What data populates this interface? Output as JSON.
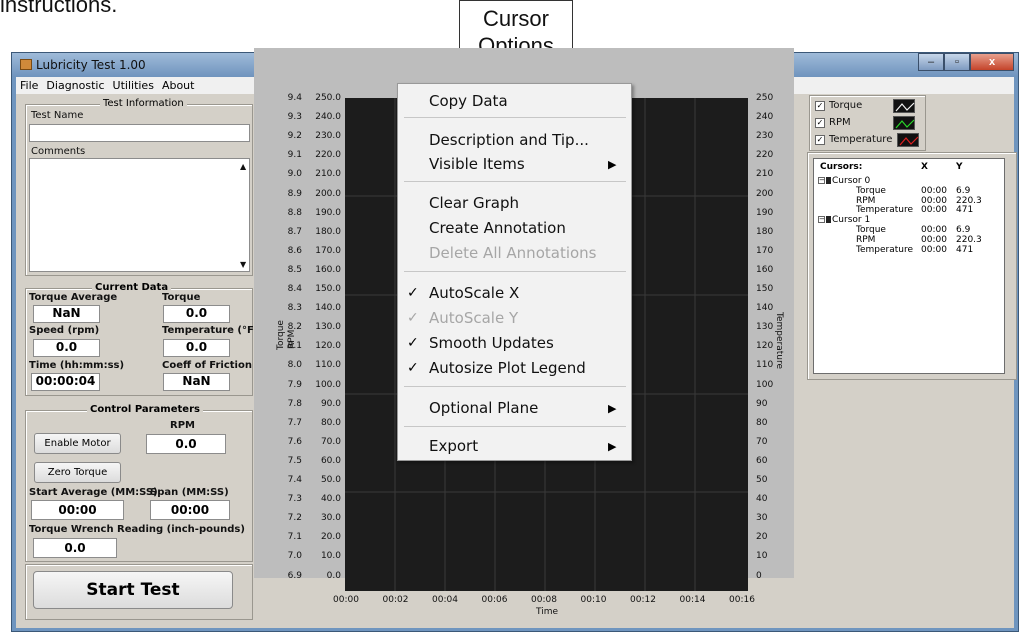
{
  "intro_text": "instructions.",
  "callout": {
    "line1": "Cursor",
    "line2": "Options"
  },
  "window": {
    "title": "Lubricity Test 1.00",
    "min": "–",
    "max": "▫",
    "close": "x"
  },
  "menubar": [
    "File",
    "Diagnostic",
    "Utilities",
    "About"
  ],
  "test_info": {
    "legend": "Test Information",
    "test_name_label": "Test Name",
    "test_name_value": "",
    "comments_label": "Comments",
    "comments_value": ""
  },
  "current_data": {
    "legend": "Current Data",
    "torque_avg_label": "Torque Average",
    "torque_avg_value": "NaN",
    "torque_label": "Torque",
    "torque_value": "0.0",
    "speed_label": "Speed (rpm)",
    "speed_value": "0.0",
    "temperature_label": "Temperature (°F)",
    "temperature_value": "0.0",
    "time_label": "Time (hh:mm:ss)",
    "time_value": "00:00:04",
    "cof_label": "Coeff of Friction",
    "cof_value": "NaN"
  },
  "control": {
    "legend": "Control Parameters",
    "rpm_label": "RPM",
    "rpm_value": "0.0",
    "enable_motor": "Enable Motor",
    "zero_torque": "Zero Torque",
    "start_avg_label": "Start Average (MM:SS)",
    "start_avg_value": "00:00",
    "span_label": "Span (MM:SS)",
    "span_value": "00:00",
    "wrench_label": "Torque Wrench Reading (inch-pounds)",
    "wrench_value": "0.0"
  },
  "start_test": "Start Test",
  "axes": {
    "torque_label": "Torque",
    "rpm_label": "RPM",
    "temperature_label": "Temperature",
    "x_label": "Time",
    "torque_ticks": [
      "9.4",
      "9.3",
      "9.2",
      "9.1",
      "9.0",
      "8.9",
      "8.8",
      "8.7",
      "8.6",
      "8.5",
      "8.4",
      "8.3",
      "8.2",
      "8.1",
      "8.0",
      "7.9",
      "7.8",
      "7.7",
      "7.6",
      "7.5",
      "7.4",
      "7.3",
      "7.2",
      "7.1",
      "7.0",
      "6.9"
    ],
    "rpm_ticks": [
      "250.0",
      "240.0",
      "230.0",
      "220.0",
      "210.0",
      "200.0",
      "190.0",
      "180.0",
      "170.0",
      "160.0",
      "150.0",
      "140.0",
      "130.0",
      "120.0",
      "110.0",
      "100.0",
      "90.0",
      "80.0",
      "70.0",
      "60.0",
      "50.0",
      "40.0",
      "30.0",
      "20.0",
      "10.0",
      "0.0"
    ],
    "temp_ticks": [
      "250",
      "240",
      "230",
      "220",
      "210",
      "200",
      "190",
      "180",
      "170",
      "160",
      "150",
      "140",
      "130",
      "120",
      "110",
      "100",
      "90",
      "80",
      "70",
      "60",
      "50",
      "40",
      "30",
      "20",
      "10",
      "0"
    ],
    "x_ticks": [
      "00:00",
      "00:02",
      "00:04",
      "00:06",
      "00:08",
      "00:10",
      "00:12",
      "00:14",
      "00:16"
    ]
  },
  "context_menu": {
    "copy_data": "Copy Data",
    "description": "Description and Tip...",
    "visible_items": "Visible Items",
    "clear_graph": "Clear Graph",
    "create_annotation": "Create Annotation",
    "delete_annotations": "Delete All Annotations",
    "autoscale_x": "AutoScale X",
    "autoscale_y": "AutoScale Y",
    "smooth_updates": "Smooth Updates",
    "autosize_legend": "Autosize Plot Legend",
    "optional_plane": "Optional Plane",
    "export": "Export",
    "check": "✓",
    "submenu_arrow": "▶"
  },
  "plot_legend": [
    {
      "label": "Torque",
      "color": "#f2f2f2"
    },
    {
      "label": "RPM",
      "color": "#29d629"
    },
    {
      "label": "Temperature",
      "color": "#e02020"
    }
  ],
  "cursors": {
    "header": [
      "Cursors:",
      "X",
      "Y"
    ],
    "rows": [
      {
        "name": "Cursor 0",
        "type": "cursor",
        "x": "",
        "y": ""
      },
      {
        "name": "Torque",
        "type": "item",
        "x": "00:00",
        "y": "6.9"
      },
      {
        "name": "RPM",
        "type": "item",
        "x": "00:00",
        "y": "220.3"
      },
      {
        "name": "Temperature",
        "type": "item",
        "x": "00:00",
        "y": "471"
      },
      {
        "name": "Cursor 1",
        "type": "cursor",
        "x": "",
        "y": ""
      },
      {
        "name": "Torque",
        "type": "item",
        "x": "00:00",
        "y": "6.9"
      },
      {
        "name": "RPM",
        "type": "item",
        "x": "00:00",
        "y": "220.3"
      },
      {
        "name": "Temperature",
        "type": "item",
        "x": "00:00",
        "y": "471"
      }
    ]
  }
}
